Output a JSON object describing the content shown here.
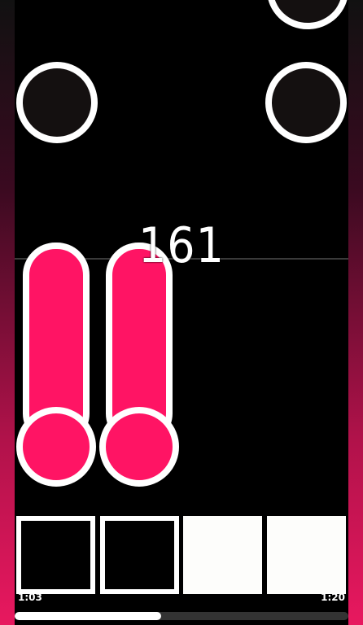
{
  "game": {
    "combo": "161",
    "accent_color": "#ff1464",
    "note_color": "#141010",
    "outline_color": "#ffffff"
  },
  "keys": [
    {
      "name": "lane-1",
      "pressed": false
    },
    {
      "name": "lane-2",
      "pressed": false
    },
    {
      "name": "lane-3",
      "pressed": true
    },
    {
      "name": "lane-4",
      "pressed": true
    }
  ],
  "song": {
    "elapsed": "1:03",
    "duration": "1:20",
    "progress": 0.44
  }
}
